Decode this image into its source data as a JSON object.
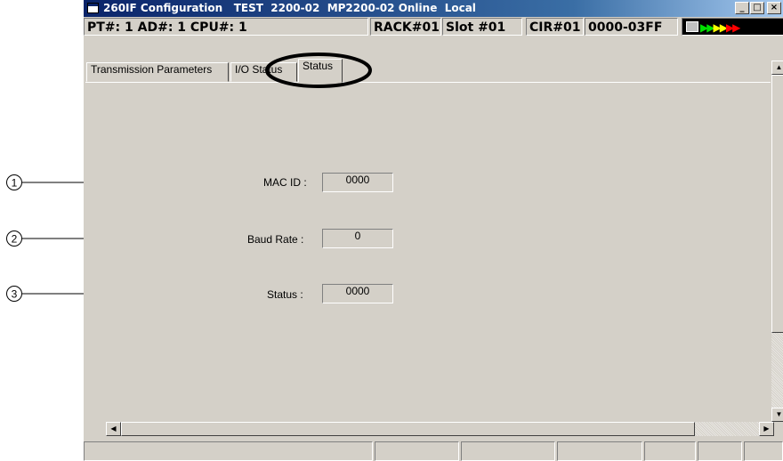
{
  "window": {
    "title": "260IF Configuration   TEST  2200-02  MP2200-02 Online  Local",
    "controls": {
      "minimize": "_",
      "maximize": "□",
      "close": "×"
    }
  },
  "infobar": {
    "pt_ad_cpu": "PT#: 1 AD#:  1 CPU#: 1",
    "rack": "RACK#01",
    "slot": "Slot #01",
    "cir": "CIR#01",
    "address_range": "0000-03FF"
  },
  "tabs": [
    {
      "label": "Transmission Parameters"
    },
    {
      "label": "I/O Status"
    },
    {
      "label": "Status",
      "selected": true
    }
  ],
  "fields": {
    "mac_id": {
      "label": "MAC ID :",
      "value": "0000"
    },
    "baud_rate": {
      "label": "Baud Rate :",
      "value": "0"
    },
    "status": {
      "label": "Status :",
      "value": "0000"
    }
  },
  "callouts": [
    "1",
    "2",
    "3"
  ],
  "colors": {
    "titlebar": "#0a246a",
    "led_green": "#00e000",
    "led_yellow": "#ffff00",
    "led_red": "#ff0000",
    "face": "#d4d0c8"
  },
  "icons": {
    "window": "app-window-icon",
    "monitor": "monitor-icon"
  }
}
